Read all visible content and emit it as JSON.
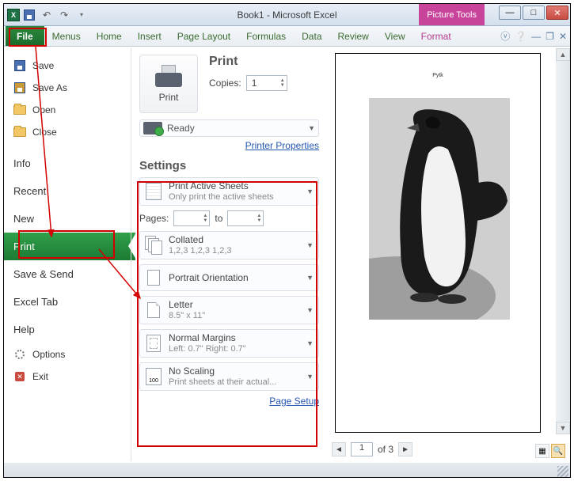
{
  "title": "Book1 - Microsoft Excel",
  "picture_tools": "Picture Tools",
  "ribbon": {
    "file": "File",
    "tabs": [
      "Menus",
      "Home",
      "Insert",
      "Page Layout",
      "Formulas",
      "Data",
      "Review",
      "View"
    ],
    "format": "Format"
  },
  "backstage": {
    "save": "Save",
    "save_as": "Save As",
    "open": "Open",
    "close": "Close",
    "info": "Info",
    "recent": "Recent",
    "new": "New",
    "print": "Print",
    "save_send": "Save & Send",
    "excel_tab": "Excel Tab",
    "help": "Help",
    "options": "Options",
    "exit": "Exit"
  },
  "print": {
    "heading": "Print",
    "button": "Print",
    "copies_label": "Copies:",
    "copies_value": "1",
    "ready": "Ready",
    "printer_properties": "Printer Properties",
    "settings": "Settings",
    "opt_active_sheets": "Print Active Sheets",
    "opt_active_sheets_sub": "Only print the active sheets",
    "pages_label": "Pages:",
    "to_label": "to",
    "opt_collated": "Collated",
    "opt_collated_sub": "1,2,3   1,2,3   1,2,3",
    "opt_orientation": "Portrait Orientation",
    "opt_paper": "Letter",
    "opt_paper_sub": "8.5\" x 11\"",
    "opt_margins": "Normal Margins",
    "opt_margins_sub": "Left: 0.7\"   Right: 0.7\"",
    "opt_scaling": "No Scaling",
    "opt_scaling_sub": "Print sheets at their actual...",
    "scale_100": "100",
    "page_setup": "Page Setup"
  },
  "preview": {
    "page_label_tiny": "Pytk",
    "page_current": "1",
    "page_total": "of 3"
  }
}
